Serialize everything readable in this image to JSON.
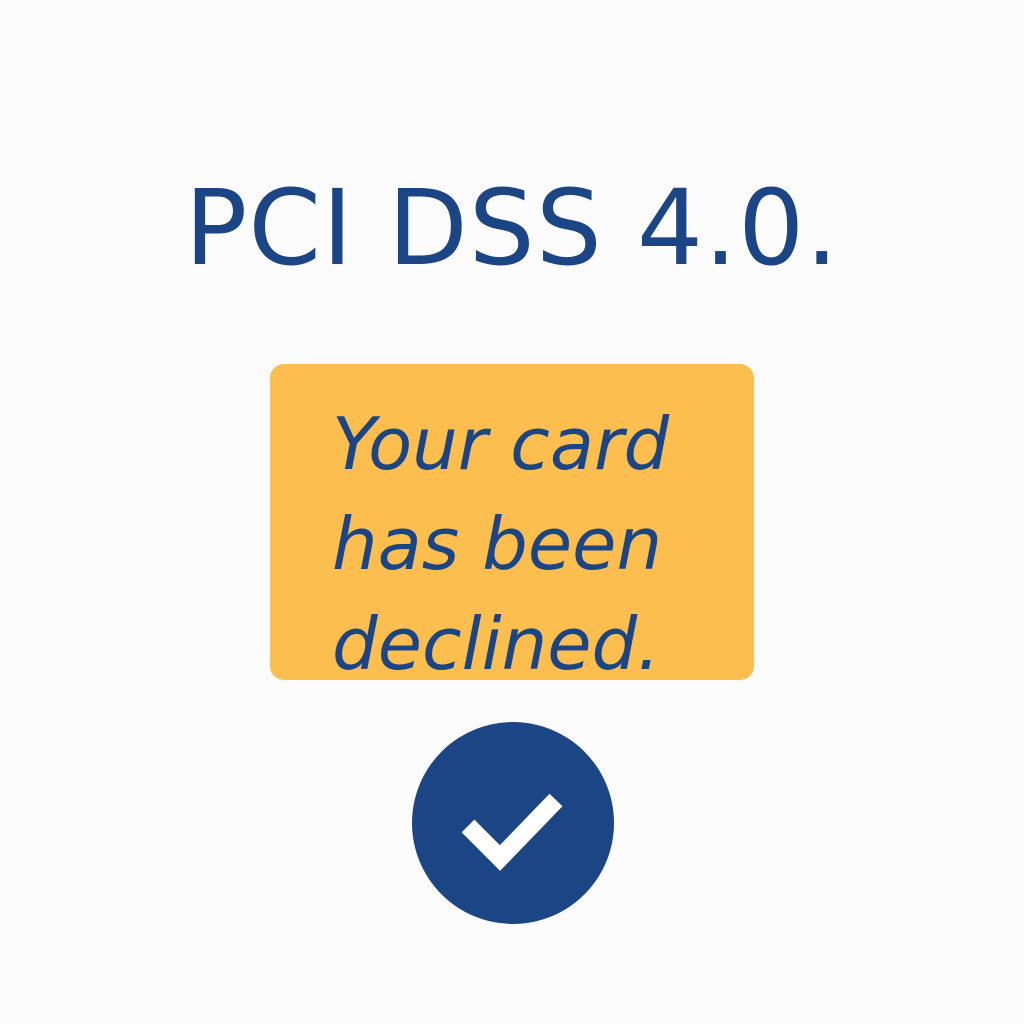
{
  "heading": {
    "text": "PCI DSS 4.0."
  },
  "alert": {
    "lines": [
      "Your card",
      "has been",
      "declined."
    ]
  },
  "badge": {
    "icon": "checkmark-icon"
  },
  "colors": {
    "background": "#fbfbfb",
    "primary": "#1c4586",
    "alert_background": "#fbbe4f",
    "check_color": "#ffffff"
  }
}
